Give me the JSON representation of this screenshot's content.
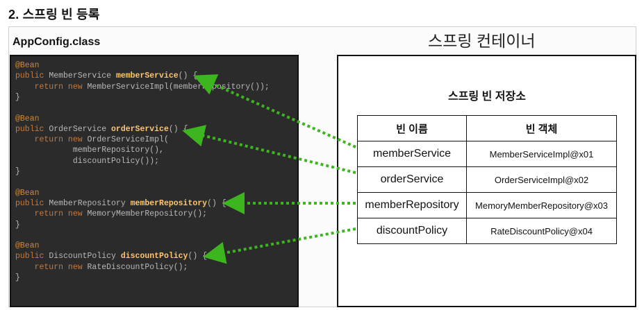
{
  "section_title": "2. 스프링 빈 등록",
  "config_file": "AppConfig.class",
  "code_lines": [
    [
      {
        "t": "@Bean",
        "c": "ann"
      }
    ],
    [
      {
        "t": "public ",
        "c": "kw"
      },
      {
        "t": "MemberService ",
        "c": "txt"
      },
      {
        "t": "memberService",
        "c": "fn"
      },
      {
        "t": "() {",
        "c": "txt"
      }
    ],
    [
      {
        "t": "    return new ",
        "c": "kw"
      },
      {
        "t": "MemberServiceImpl(memberRepository());",
        "c": "txt"
      }
    ],
    [
      {
        "t": "}",
        "c": "txt"
      }
    ],
    [
      {
        "t": "",
        "c": "txt"
      }
    ],
    [
      {
        "t": "@Bean",
        "c": "ann"
      }
    ],
    [
      {
        "t": "public ",
        "c": "kw"
      },
      {
        "t": "OrderService ",
        "c": "txt"
      },
      {
        "t": "orderService",
        "c": "fn"
      },
      {
        "t": "() {",
        "c": "txt"
      }
    ],
    [
      {
        "t": "    return new ",
        "c": "kw"
      },
      {
        "t": "OrderServiceImpl(",
        "c": "txt"
      }
    ],
    [
      {
        "t": "            memberRepository(),",
        "c": "txt"
      }
    ],
    [
      {
        "t": "            discountPolicy());",
        "c": "txt"
      }
    ],
    [
      {
        "t": "}",
        "c": "txt"
      }
    ],
    [
      {
        "t": "",
        "c": "txt"
      }
    ],
    [
      {
        "t": "@Bean",
        "c": "ann"
      }
    ],
    [
      {
        "t": "public ",
        "c": "kw"
      },
      {
        "t": "MemberRepository ",
        "c": "txt"
      },
      {
        "t": "memberRepository",
        "c": "fn"
      },
      {
        "t": "() {",
        "c": "txt"
      }
    ],
    [
      {
        "t": "    return new ",
        "c": "kw"
      },
      {
        "t": "MemoryMemberRepository();",
        "c": "txt"
      }
    ],
    [
      {
        "t": "}",
        "c": "txt"
      }
    ],
    [
      {
        "t": "",
        "c": "txt"
      }
    ],
    [
      {
        "t": "@Bean",
        "c": "ann"
      }
    ],
    [
      {
        "t": "public ",
        "c": "kw"
      },
      {
        "t": "DiscountPolicy ",
        "c": "txt"
      },
      {
        "t": "discountPolicy",
        "c": "fn"
      },
      {
        "t": "() {",
        "c": "txt"
      }
    ],
    [
      {
        "t": "    return new ",
        "c": "kw"
      },
      {
        "t": "RateDiscountPolicy();",
        "c": "txt"
      }
    ],
    [
      {
        "t": "}",
        "c": "txt"
      }
    ]
  ],
  "container_title": "스프링 컨테이너",
  "store_title": "스프링 빈 저장소",
  "table": {
    "headers": [
      "빈 이름",
      "빈 객체"
    ],
    "rows": [
      [
        "memberService",
        "MemberServiceImpl@x01"
      ],
      [
        "orderService",
        "OrderServiceImpl@x02"
      ],
      [
        "memberRepository",
        "MemoryMemberRepository@x03"
      ],
      [
        "discountPolicy",
        "RateDiscountPolicy@x04"
      ]
    ]
  },
  "colors": {
    "arrow": "#3cb51e",
    "code_bg": "#2b2b2b",
    "keyword": "#cc7832",
    "method": "#ffc66d"
  }
}
